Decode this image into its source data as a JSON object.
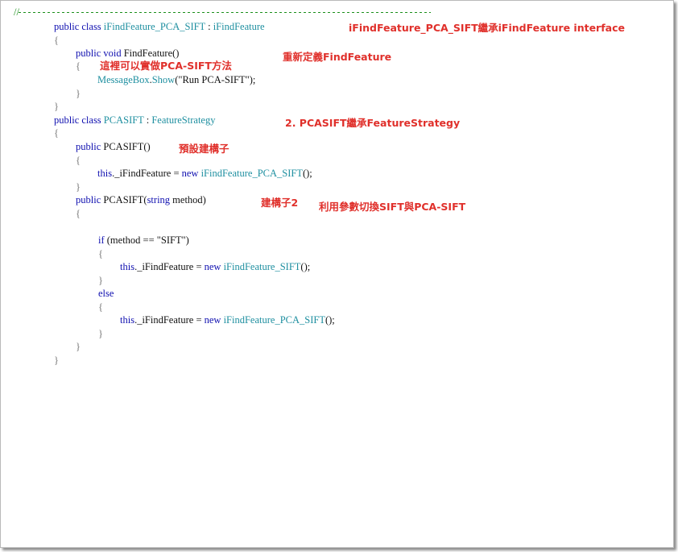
{
  "code": {
    "separator_prefix": "//",
    "lines": {
      "l1": {
        "kw": "public class ",
        "type": "iFindFeature_PCA_SIFT",
        "sep": " : ",
        "base": "iFindFeature"
      },
      "l2": {
        "brace": "{"
      },
      "l3": {
        "kw": "public void ",
        "plain": "FindFeature()"
      },
      "l4": {
        "brace": "{"
      },
      "l5": {
        "type": "MessageBox",
        "plain1": ".",
        "method": "Show",
        "plain2": "(\"Run PCA-SIFT\");"
      },
      "l6": {
        "brace": "}"
      },
      "l7": {
        "brace": "}"
      },
      "l8": {
        "kw": "public class ",
        "type": "PCASIFT",
        "sep": " : ",
        "base": "FeatureStrategy"
      },
      "l9": {
        "brace": "{"
      },
      "l10": {
        "kw": "public ",
        "plain": "PCASIFT()"
      },
      "l11": {
        "brace": "{"
      },
      "l12": {
        "kw": "this",
        "plain": "._iFindFeature = ",
        "kw2": "new ",
        "type": "iFindFeature_PCA_SIFT",
        "plain2": "();"
      },
      "l13": {
        "brace": "}"
      },
      "l14": {
        "kw": "public ",
        "plain": "PCASIFT(",
        "kw2": "string",
        "plain2": " method)"
      },
      "l15": {
        "brace": "{"
      },
      "l16": {
        "kw": "if ",
        "plain": "(method == \"SIFT\")"
      },
      "l17": {
        "brace": "{"
      },
      "l18": {
        "kw": "this",
        "plain": "._iFindFeature = ",
        "kw2": "new ",
        "type": "iFindFeature_SIFT",
        "plain2": "();"
      },
      "l19": {
        "brace": "}"
      },
      "l20": {
        "kw": "else"
      },
      "l21": {
        "brace": "{"
      },
      "l22": {
        "kw": "this",
        "plain": "._iFindFeature = ",
        "kw2": "new ",
        "type": "iFindFeature_PCA_SIFT",
        "plain2": "();"
      },
      "l23": {
        "brace": "}"
      },
      "l24": {
        "brace": "}"
      },
      "l25": {
        "brace": "}"
      }
    }
  },
  "annotations": {
    "inherit_note": "iFindFeature_PCA_SIFT繼承iFindFeature interface",
    "override_note": "重新定義FindFeature",
    "implement_note": "這裡可以實做PCA-SIFT方法",
    "strategy_note": "2.  PCASIFT繼承FeatureStrategy",
    "default_ctor_note": "預設建構子",
    "ctor2_note": "建構子2",
    "switch_note": "利用參數切換SIFT與PCA-SIFT"
  },
  "colors": {
    "keyword": "#1010b0",
    "type": "#1e8fa0",
    "comment": "#1a8f1a",
    "annotation": "#e0302b"
  }
}
